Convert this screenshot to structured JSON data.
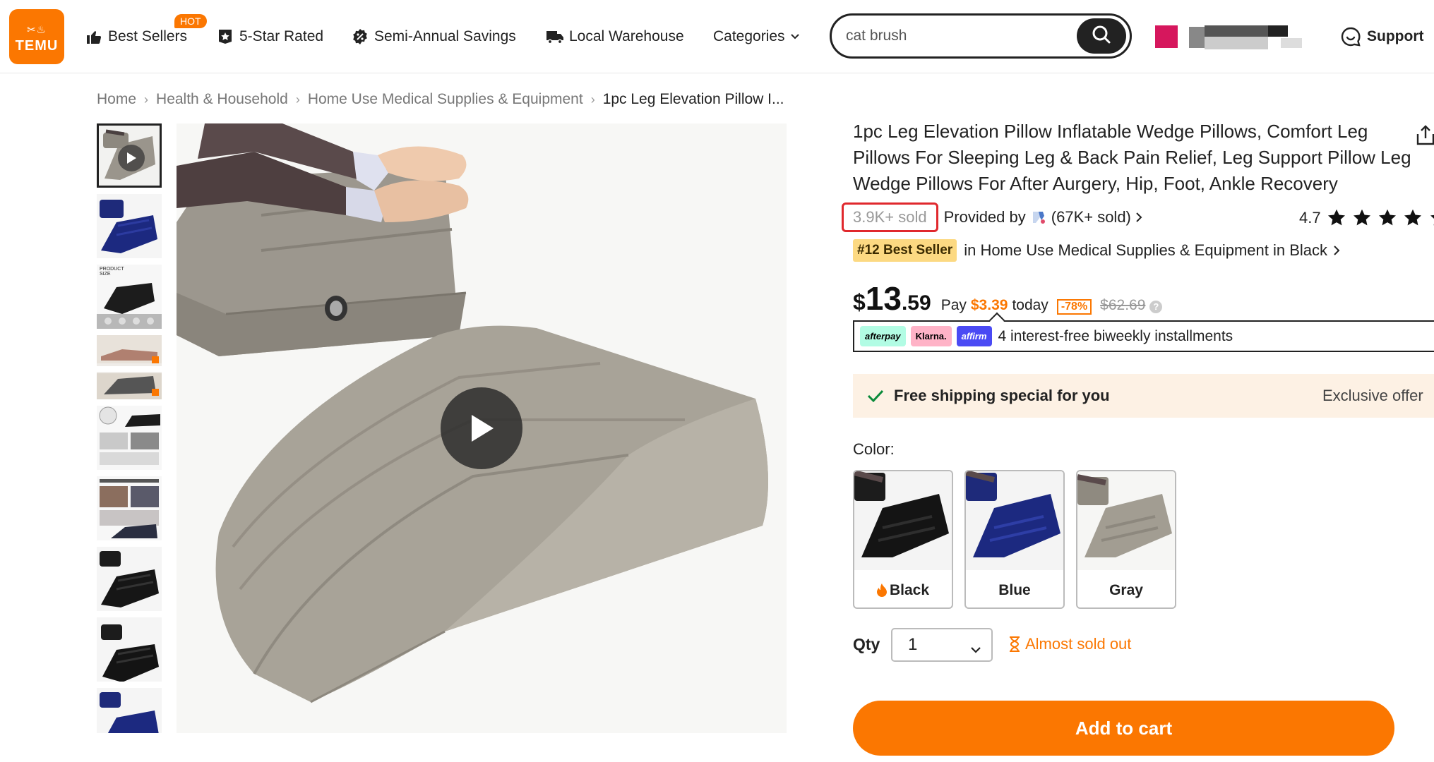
{
  "header": {
    "logo": {
      "icons": "✂︎♨︎",
      "text": "TEMU"
    },
    "nav": [
      {
        "label": "Best Sellers",
        "icon": "thumbs-up-icon",
        "badge": "HOT"
      },
      {
        "label": "5-Star Rated",
        "icon": "star-badge-icon"
      },
      {
        "label": "Semi-Annual Savings",
        "icon": "percent-badge-icon"
      },
      {
        "label": "Local Warehouse",
        "icon": "truck-icon"
      },
      {
        "label": "Categories",
        "icon": "chevron-down-icon"
      }
    ],
    "search": {
      "value": "cat brush",
      "icon": "search-icon"
    },
    "support_label": "Support"
  },
  "breadcrumb": {
    "items": [
      "Home",
      "Health & Household",
      "Home Use Medical Supplies & Equipment",
      "1pc Leg Elevation Pillow I..."
    ],
    "separator": "›"
  },
  "product": {
    "title": "1pc Leg Elevation Pillow Inflatable Wedge Pillows, Comfort Leg Pillows For Sleeping Leg & Back Pain Relief, Leg Support Pillow Leg Wedge Pillows For After Aurgery, Hip, Foot, Ankle Recovery",
    "sold": "3.9K+ sold",
    "provided_by": "Provided by",
    "provider_sold": "(67K+ sold)",
    "rating": "4.7",
    "best_seller_badge": "#12 Best Seller",
    "best_seller_text": "in Home Use Medical Supplies & Equipment in Black",
    "price": {
      "symbol": "$",
      "integer": "13",
      "decimal": ".59",
      "pay_label": "Pay",
      "pay_amount": "$3.39",
      "pay_after": "today",
      "discount": "-78%",
      "original": "$62.69"
    },
    "installments": {
      "providers": [
        "afterpay",
        "Klarna.",
        "affirm"
      ],
      "text": "4 interest-free biweekly installments"
    },
    "free_shipping": {
      "text": "Free shipping special for you",
      "offer": "Exclusive offer"
    },
    "color_label": "Color:",
    "colors": [
      {
        "name": "Black",
        "hot": true,
        "swatch": "#1c1c1c"
      },
      {
        "name": "Blue",
        "hot": false,
        "swatch": "#1e2a7a"
      },
      {
        "name": "Gray",
        "hot": false,
        "swatch": "#8f8a80"
      }
    ],
    "qty_label": "Qty",
    "qty_value": "1",
    "stock_status": "Almost sold out",
    "add_to_cart": "Add to cart"
  },
  "colors": {
    "accent": "#fb7701",
    "sold_box_border": "#e0282d",
    "badge_bg": "#fcd982",
    "free_ship_bg": "#fdf1e4"
  }
}
